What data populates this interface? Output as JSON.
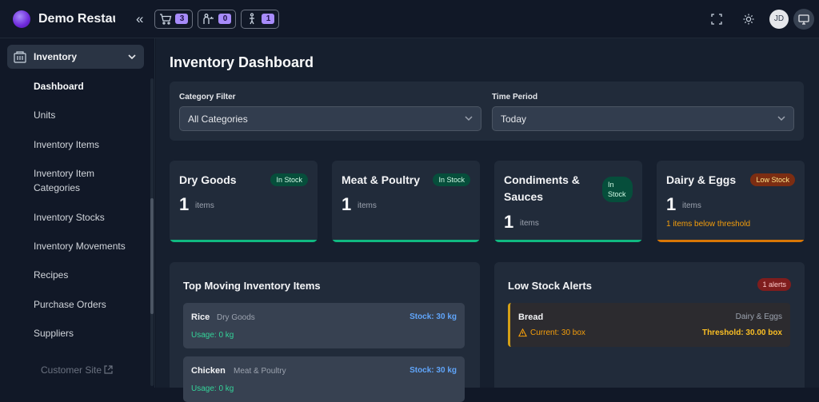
{
  "header": {
    "brand": "Demo Restaurant",
    "counters": [
      {
        "icon": "cart-icon",
        "count": "3"
      },
      {
        "icon": "waiter-icon",
        "count": "0"
      },
      {
        "icon": "person-walking-icon",
        "count": "1"
      }
    ],
    "avatar_initials": "JD",
    "icons": [
      "fullscreen-icon",
      "sun-icon",
      "monitor-icon"
    ]
  },
  "sidebar": {
    "group_label": "Inventory",
    "items": [
      {
        "label": "Dashboard",
        "active": true
      },
      {
        "label": "Units"
      },
      {
        "label": "Inventory Items"
      },
      {
        "label": "Inventory Item Categories"
      },
      {
        "label": "Inventory Stocks"
      },
      {
        "label": "Inventory Movements"
      },
      {
        "label": "Recipes"
      },
      {
        "label": "Purchase Orders"
      },
      {
        "label": "Suppliers"
      }
    ],
    "external_link": "Customer Site"
  },
  "main": {
    "title": "Inventory Dashboard",
    "filters": {
      "category_label": "Category Filter",
      "category_value": "All Categories",
      "period_label": "Time Period",
      "period_value": "Today"
    },
    "cards": [
      {
        "title": "Dry Goods",
        "count": "1",
        "unit": "items",
        "status": "In Stock"
      },
      {
        "title": "Meat & Poultry",
        "count": "1",
        "unit": "items",
        "status": "In Stock"
      },
      {
        "title": "Condiments & Sauces",
        "count": "1",
        "unit": "items",
        "status": "In Stock"
      },
      {
        "title": "Dairy & Eggs",
        "count": "1",
        "unit": "items",
        "status": "Low Stock",
        "note": "1 items below threshold"
      }
    ],
    "top_moving": {
      "title": "Top Moving Inventory Items",
      "items": [
        {
          "name": "Rice",
          "category": "Dry Goods",
          "stock": "Stock: 30 kg",
          "usage": "Usage: 0 kg"
        },
        {
          "name": "Chicken",
          "category": "Meat & Poultry",
          "stock": "Stock: 30 kg",
          "usage": "Usage: 0 kg"
        }
      ]
    },
    "low_stock": {
      "title": "Low Stock Alerts",
      "badge": "1 alerts",
      "alerts": [
        {
          "name": "Bread",
          "category": "Dairy & Eggs",
          "current": "Current: 30 box",
          "threshold": "Threshold: 30.00 box"
        }
      ]
    }
  },
  "colors": {
    "accent": "#a78bfa",
    "in_stock": "#10b981",
    "low_stock": "#d97706",
    "link_blue": "#60a5fa"
  }
}
